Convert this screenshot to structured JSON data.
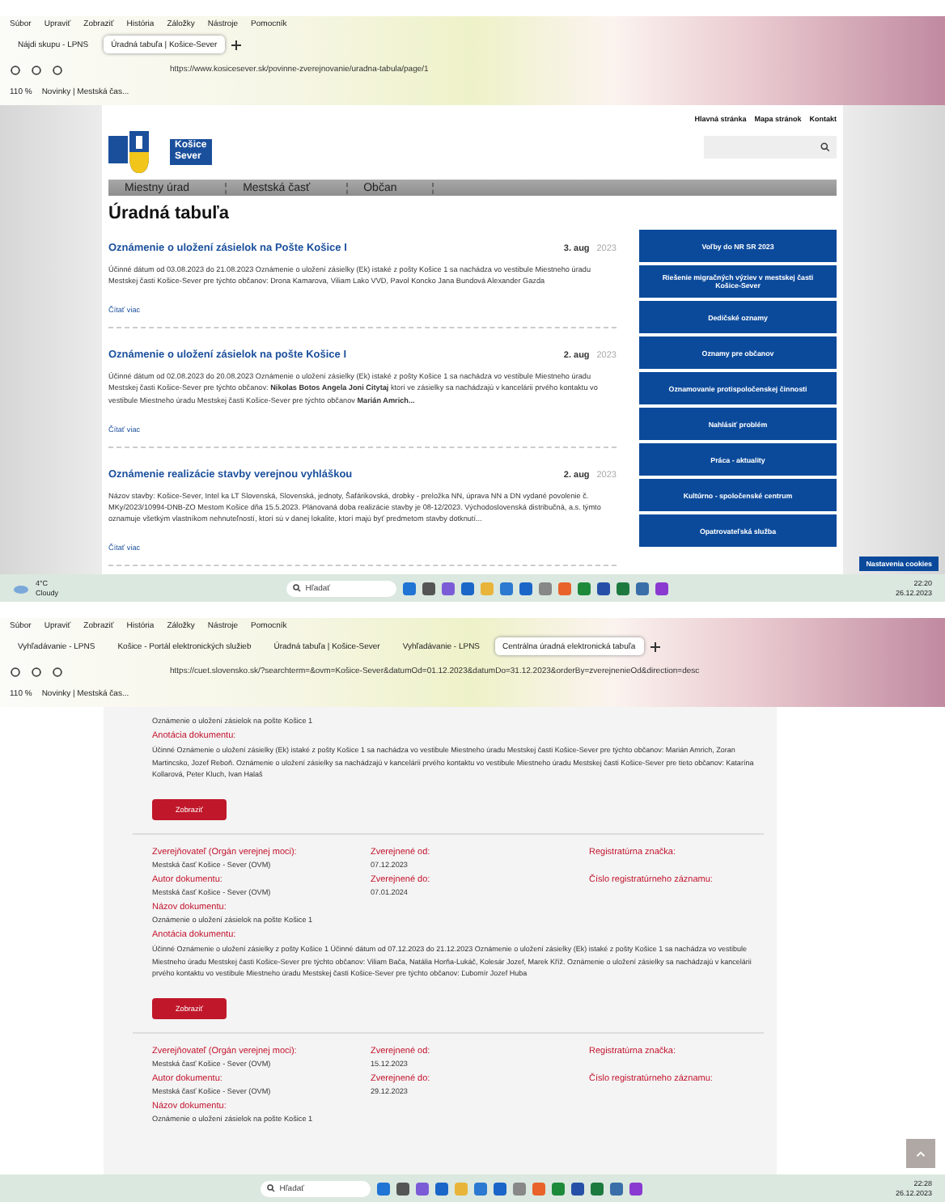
{
  "window_1": {
    "menu": [
      "Súbor",
      "Upraviť",
      "Zobraziť",
      "História",
      "Záložky",
      "Nástroje",
      "Pomocník"
    ],
    "tabs": [
      {
        "label": "Nájdi skupu - LPNS",
        "selected": false
      },
      {
        "label": "Úradná tabuľa | Košice-Sever",
        "selected": true
      }
    ],
    "url": "https://www.kosicesever.sk/povinne-zverejnovanie/uradna-tabula/page/1",
    "zoom": "110 %",
    "bookmark": "Novinky | Mestská čas...",
    "page": {
      "top_links": [
        "Hlavná stránka",
        "Mapa stránok",
        "Kontakt"
      ],
      "logo_text": [
        "Košice",
        "Sever"
      ],
      "nav": [
        {
          "label": "Miestny úrad",
          "selected": false
        },
        {
          "label": "Mestská časť",
          "selected": false
        },
        {
          "label": "Občan",
          "selected": false
        }
      ],
      "heading": "Úradná tabuľa",
      "posts": [
        {
          "title": "Oznámenie o uložení zásielok na Pošte Košice I",
          "day": "3. aug",
          "year": "2023",
          "excerpt": "Účinné dátum od 03.08.2023 do 21.08.2023 Oznámenie o uložení zásielky (Ek) istaké z pošty Košice 1 sa nachádza vo vestibule Miestneho úradu Mestskej časti Košice-Sever pre týchto občanov: Drona Kamarova, Viliam Lako VVD, Pavol Koncko Jana Bundová Alexander Gazda",
          "more": "Čítať viac"
        },
        {
          "title": "Oznámenie o uložení zásielok na pošte Košice I",
          "day": "2. aug",
          "year": "2023",
          "excerpt": "Účinné dátum od 02.08.2023 do 20.08.2023 Oznámenie o uložení zásielky (Ek) istaké z pošty Košice 1 sa nachádza vo vestibule Miestneho úradu Mestskej časti Košice-Sever pre týchto občanov: **Nikolas Botos Angela Joni Citytaj** ktorí ve zásielky sa nachádzajú v kancelárii prvého kontaktu vo vestibule Miestneho úradu Mestskej časti Košice-Sever pre týchto občanov **Marián Amrich...**",
          "more": "Čítať viac"
        },
        {
          "title": "Oznámenie realizácie stavby verejnou vyhláškou",
          "day": "2. aug",
          "year": "2023",
          "excerpt": "Názov stavby: Košice-Sever, Intel ka LT Slovenská, Slovenská, jednoty, Šafárikovská, drobky - preložka NN, úprava NN a DN vydané povolenie č. MKy/2023/10994-DNB-ZO Mestom Košice dňa 15.5.2023. Plánovaná doba realizácie stavby je 08-12/2023. Východoslovenská distribučná, a.s. týmto oznamuje všetkým vlastníkom nehnuteľností, ktorí sú v danej lokalite, ktorí majú byť predmetom stavby dotknutí...",
          "more": "Čítať viac"
        }
      ],
      "side_buttons": [
        "Voľby do NR SR 2023",
        "Riešenie migračných výziev v mestskej časti Košice-Sever",
        "Dedičské oznamy",
        "Oznamy pre občanov",
        "Oznamovanie protispoločenskej činnosti",
        "Nahlásiť problém",
        "Práca - aktuality",
        "Kultúrno - spoločenské centrum",
        "Opatrovateľská služba"
      ]
    },
    "cookie_button": "Nastavenia cookies",
    "taskbar": {
      "temp": "4°C",
      "weather": "Cloudy",
      "search": "Hľadať",
      "time": "22:20",
      "date": "26.12.2023"
    }
  },
  "window_2": {
    "menu": [
      "Súbor",
      "Upraviť",
      "Zobraziť",
      "História",
      "Záložky",
      "Nástroje",
      "Pomocník"
    ],
    "tabs": [
      {
        "label": "Vyhľadávanie - LPNS",
        "selected": false
      },
      {
        "label": "Košice - Portál elektronických služieb",
        "selected": false
      },
      {
        "label": "Úradná tabuľa | Košice-Sever",
        "selected": false
      },
      {
        "label": "Vyhľadávanie - LPNS",
        "selected": false
      },
      {
        "label": "Centrálna úradná elektronická tabuľa",
        "selected": true
      }
    ],
    "url": "https://cuet.slovensko.sk/?searchterm=&ovm=Košice-Sever&datumOd=01.12.2023&datumDo=31.12.2023&orderBy=zverejnenieOd&direction=desc",
    "zoom": "110 %",
    "bookmark": "Novinky | Mestská čas...",
    "page": {
      "partial": {
        "doc_name": "Oznámenie o uložení zásielok na pošte Košice 1",
        "annotation_label": "Anotácia dokumentu:",
        "annotation": "Účinné Oznámenie o uložení zásielky (Ek) istaké z pošty Košice 1 sa nachádza vo vestibule Miestneho úradu Mestskej časti Košice-Sever pre týchto občanov: Marián Amrich, Zoran Martincsko, Jozef Reboň. Oznámenie o uložení zásielky sa nachádzajú v kancelárii prvého kontaktu vo vestibule Miestneho úradu Mestskej časti Košice-Sever pre tieto občanov: Katarína Kollarová, Peter Kluch, Ivan Halaš",
        "button": "Zobraziť"
      },
      "records": [
        {
          "publisher_label": "Zverejňovateľ (Orgán verejnej moci):",
          "publisher": "Mestská časť Košice - Sever (OVM)",
          "from_label": "Zverejnené od:",
          "from": "07.12.2023",
          "reg_label": "Registratúrna značka:",
          "author_label": "Autor dokumentu:",
          "author": "Mestská časť Košice - Sever (OVM)",
          "to_label": "Zverejnené do:",
          "to": "07.01.2024",
          "num_label": "Číslo registratúrneho záznamu:",
          "name_label": "Názov dokumentu:",
          "name": "Oznámenie o uložení zásielok na pošte Košice 1",
          "annotation_label": "Anotácia dokumentu:",
          "annotation": "Účinné Oznámenie o uložení zásielky z pošty Košice 1 Účinné dátum od 07.12.2023 do 21.12.2023 Oznámenie o uložení zásielky (Ek) istaké z pošty Košice 1 sa nachádza vo vestibule Miestneho úradu Mestskej časti Košice-Sever pre týchto občanov: Viliam Bača, Natália Horňa-Lukáč, Kolesár Jozef, Marek Kříž. Oznámenie o uložení zásielky sa nachádzajú v kancelárii prvého kontaktu vo vestibule Miestneho úradu Mestskej časti Košice-Sever pre týchto občanov: Ľubomír Jozef Huba",
          "button": "Zobraziť"
        },
        {
          "publisher_label": "Zverejňovateľ (Orgán verejnej moci):",
          "publisher": "Mestská časť Košice - Sever (OVM)",
          "from_label": "Zverejnené od:",
          "from": "15.12.2023",
          "reg_label": "Registratúrna značka:",
          "author_label": "Autor dokumentu:",
          "author": "Mestská časť Košice - Sever (OVM)",
          "to_label": "Zverejnené do:",
          "to": "29.12.2023",
          "num_label": "Číslo registratúrneho záznamu:",
          "name_label": "Názov dokumentu:",
          "name": "Oznámenie o uložení zásielok na pošte Košice 1"
        }
      ]
    },
    "taskbar": {
      "search": "Hľadať",
      "time": "22:28",
      "date": "26.12.2023"
    }
  }
}
